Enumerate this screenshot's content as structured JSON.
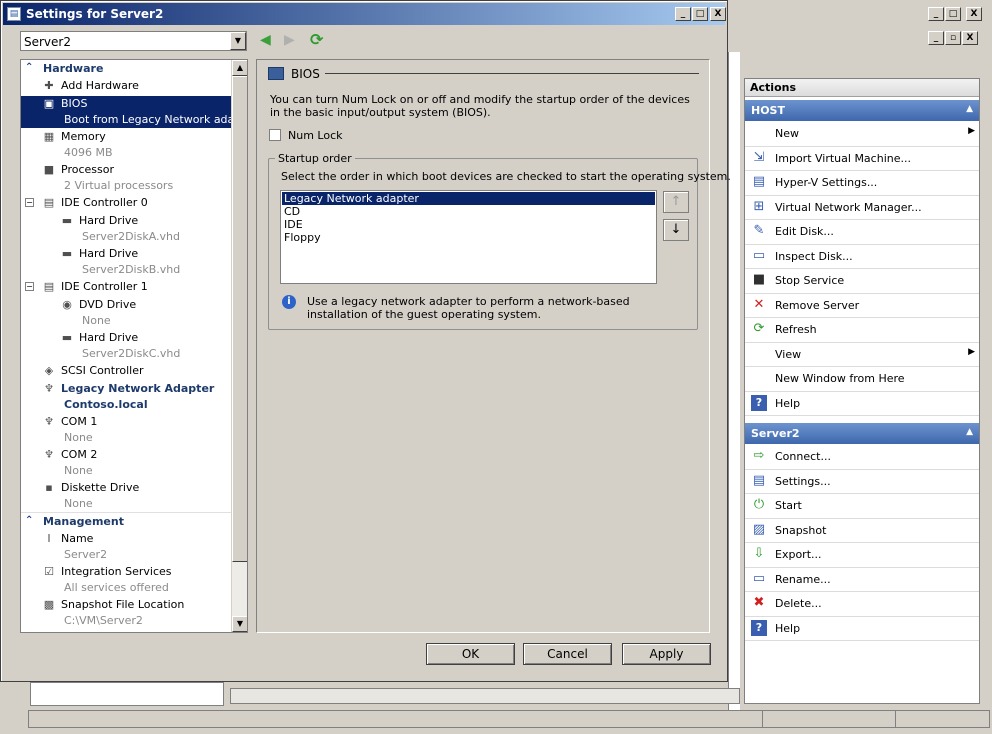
{
  "dialog": {
    "title": "Settings for Server2",
    "vm_selector": "Server2",
    "min_btn": "_",
    "max_btn": "□",
    "close_btn": "X"
  },
  "tree": {
    "hardware_header": "Hardware",
    "management_header": "Management",
    "items": [
      {
        "label": "Add Hardware",
        "icon": "add-hardware-icon"
      },
      {
        "label": "BIOS",
        "sub": "Boot from Legacy Network ada...",
        "icon": "bios-icon"
      },
      {
        "label": "Memory",
        "sub": "4096 MB",
        "icon": "memory-icon"
      },
      {
        "label": "Processor",
        "sub": "2 Virtual processors",
        "icon": "processor-icon"
      },
      {
        "label": "IDE Controller 0",
        "icon": "ide-controller-icon"
      },
      {
        "label": "Hard Drive",
        "sub": "Server2DiskA.vhd",
        "icon": "hard-drive-icon"
      },
      {
        "label": "Hard Drive",
        "sub": "Server2DiskB.vhd",
        "icon": "hard-drive-icon"
      },
      {
        "label": "IDE Controller 1",
        "icon": "ide-controller-icon"
      },
      {
        "label": "DVD Drive",
        "sub": "None",
        "icon": "dvd-drive-icon"
      },
      {
        "label": "Hard Drive",
        "sub": "Server2DiskC.vhd",
        "icon": "hard-drive-icon"
      },
      {
        "label": "SCSI Controller",
        "icon": "scsi-controller-icon"
      },
      {
        "label": "Legacy Network Adapter",
        "sub": "Contoso.local",
        "icon": "network-adapter-icon"
      },
      {
        "label": "COM 1",
        "sub": "None",
        "icon": "com-port-icon"
      },
      {
        "label": "COM 2",
        "sub": "None",
        "icon": "com-port-icon"
      },
      {
        "label": "Diskette Drive",
        "sub": "None",
        "icon": "diskette-drive-icon"
      },
      {
        "label": "Name",
        "sub": "Server2",
        "icon": "name-icon"
      },
      {
        "label": "Integration Services",
        "sub": "All services offered",
        "icon": "integration-services-icon"
      },
      {
        "label": "Snapshot File Location",
        "sub": "C:\\VM\\Server2",
        "icon": "snapshot-location-icon"
      }
    ]
  },
  "bios": {
    "title": "BIOS",
    "description": "You can turn Num Lock on or off and modify the startup order of the devices in the basic input/output system (BIOS).",
    "numlock_label": "Num Lock",
    "startup_group": "Startup order",
    "startup_desc": "Select the order in which boot devices are checked to start the operating system.",
    "boot_devices": [
      "Legacy Network adapter",
      "CD",
      "IDE",
      "Floppy"
    ],
    "info_text": "Use a legacy network adapter to perform a network-based installation of the guest operating system.",
    "up_arrow": "↑",
    "down_arrow": "↓"
  },
  "buttons": {
    "ok": "OK",
    "cancel": "Cancel",
    "apply": "Apply"
  },
  "actions": {
    "header": "Actions",
    "host_section": "HOST",
    "server_section": "Server2",
    "host_items": [
      {
        "label": "New",
        "icon": "new-icon",
        "submenu": true
      },
      {
        "label": "Import Virtual Machine...",
        "icon": "import-icon"
      },
      {
        "label": "Hyper-V Settings...",
        "icon": "hyperv-settings-icon"
      },
      {
        "label": "Virtual Network Manager...",
        "icon": "network-manager-icon"
      },
      {
        "label": "Edit Disk...",
        "icon": "edit-disk-icon"
      },
      {
        "label": "Inspect Disk...",
        "icon": "inspect-disk-icon"
      },
      {
        "label": "Stop Service",
        "icon": "stop-service-icon"
      },
      {
        "label": "Remove Server",
        "icon": "remove-server-icon"
      },
      {
        "label": "Refresh",
        "icon": "refresh-icon"
      },
      {
        "label": "View",
        "icon": "",
        "submenu": true
      },
      {
        "label": "New Window from Here",
        "icon": ""
      },
      {
        "label": "Help",
        "icon": "help-icon"
      }
    ],
    "server_items": [
      {
        "label": "Connect...",
        "icon": "connect-icon"
      },
      {
        "label": "Settings...",
        "icon": "settings-icon"
      },
      {
        "label": "Start",
        "icon": "start-icon"
      },
      {
        "label": "Snapshot",
        "icon": "snapshot-icon"
      },
      {
        "label": "Export...",
        "icon": "export-icon"
      },
      {
        "label": "Rename...",
        "icon": "rename-icon"
      },
      {
        "label": "Delete...",
        "icon": "delete-icon"
      },
      {
        "label": "Help",
        "icon": "help-icon"
      }
    ]
  },
  "colors": {
    "selection": "#0a246a",
    "title_bar": "#0a246a",
    "section_header": "#4a76b8"
  }
}
